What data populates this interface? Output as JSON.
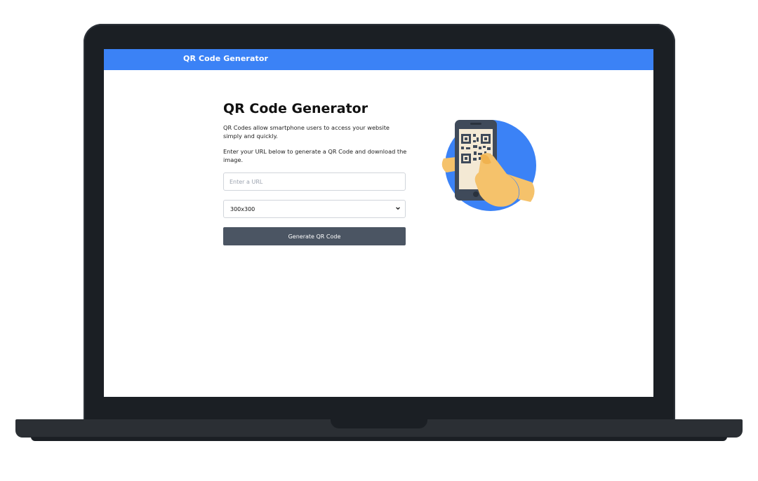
{
  "header": {
    "brand": "QR Code Generator"
  },
  "main": {
    "title": "QR Code Generator",
    "intro_text": "QR Codes allow smartphone users to access your website simply and quickly.",
    "instructions_text": "Enter your URL below to generate a QR Code and download the image.",
    "url_input": {
      "placeholder": "Enter a URL",
      "value": ""
    },
    "size_select": {
      "selected": "300x300"
    },
    "generate_button": {
      "label": "Generate QR Code"
    }
  },
  "colors": {
    "header_bg": "#3b82f6",
    "button_bg": "#4b5563",
    "illustration_circle": "#3b82f6",
    "laptop_frame": "#1b1f24"
  },
  "icons": {
    "illustration": "hand-holding-phone-qr-illustration",
    "select_chevron": "chevron-down-icon"
  }
}
